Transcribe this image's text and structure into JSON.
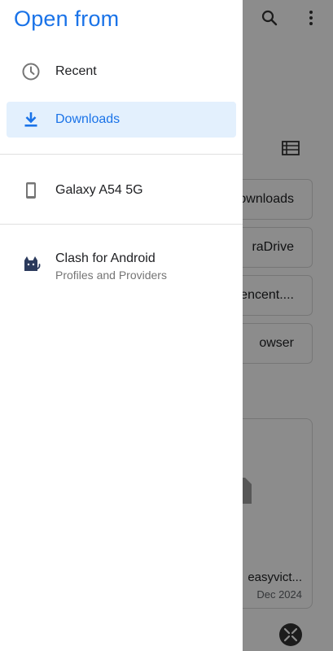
{
  "background_app": {
    "cards": [
      "ownloads",
      "raDrive",
      "tencent....",
      "owser"
    ],
    "file": {
      "name": "easyvict...",
      "date": "Dec 2024"
    }
  },
  "drawer": {
    "title": "Open from",
    "items": [
      {
        "label": "Recent",
        "icon": "clock-icon",
        "selected": false
      },
      {
        "label": "Downloads",
        "icon": "download-icon",
        "selected": true
      },
      {
        "label": "Galaxy A54 5G",
        "icon": "phone-icon",
        "selected": false
      },
      {
        "label": "Clash for Android",
        "sub": "Profiles and Providers",
        "icon": "cat-icon",
        "selected": false
      }
    ]
  },
  "colors": {
    "accent": "#1a73e8",
    "selected_bg": "#e3f0fd",
    "icon_gray": "#757575",
    "cat": "#2b3a5c"
  }
}
